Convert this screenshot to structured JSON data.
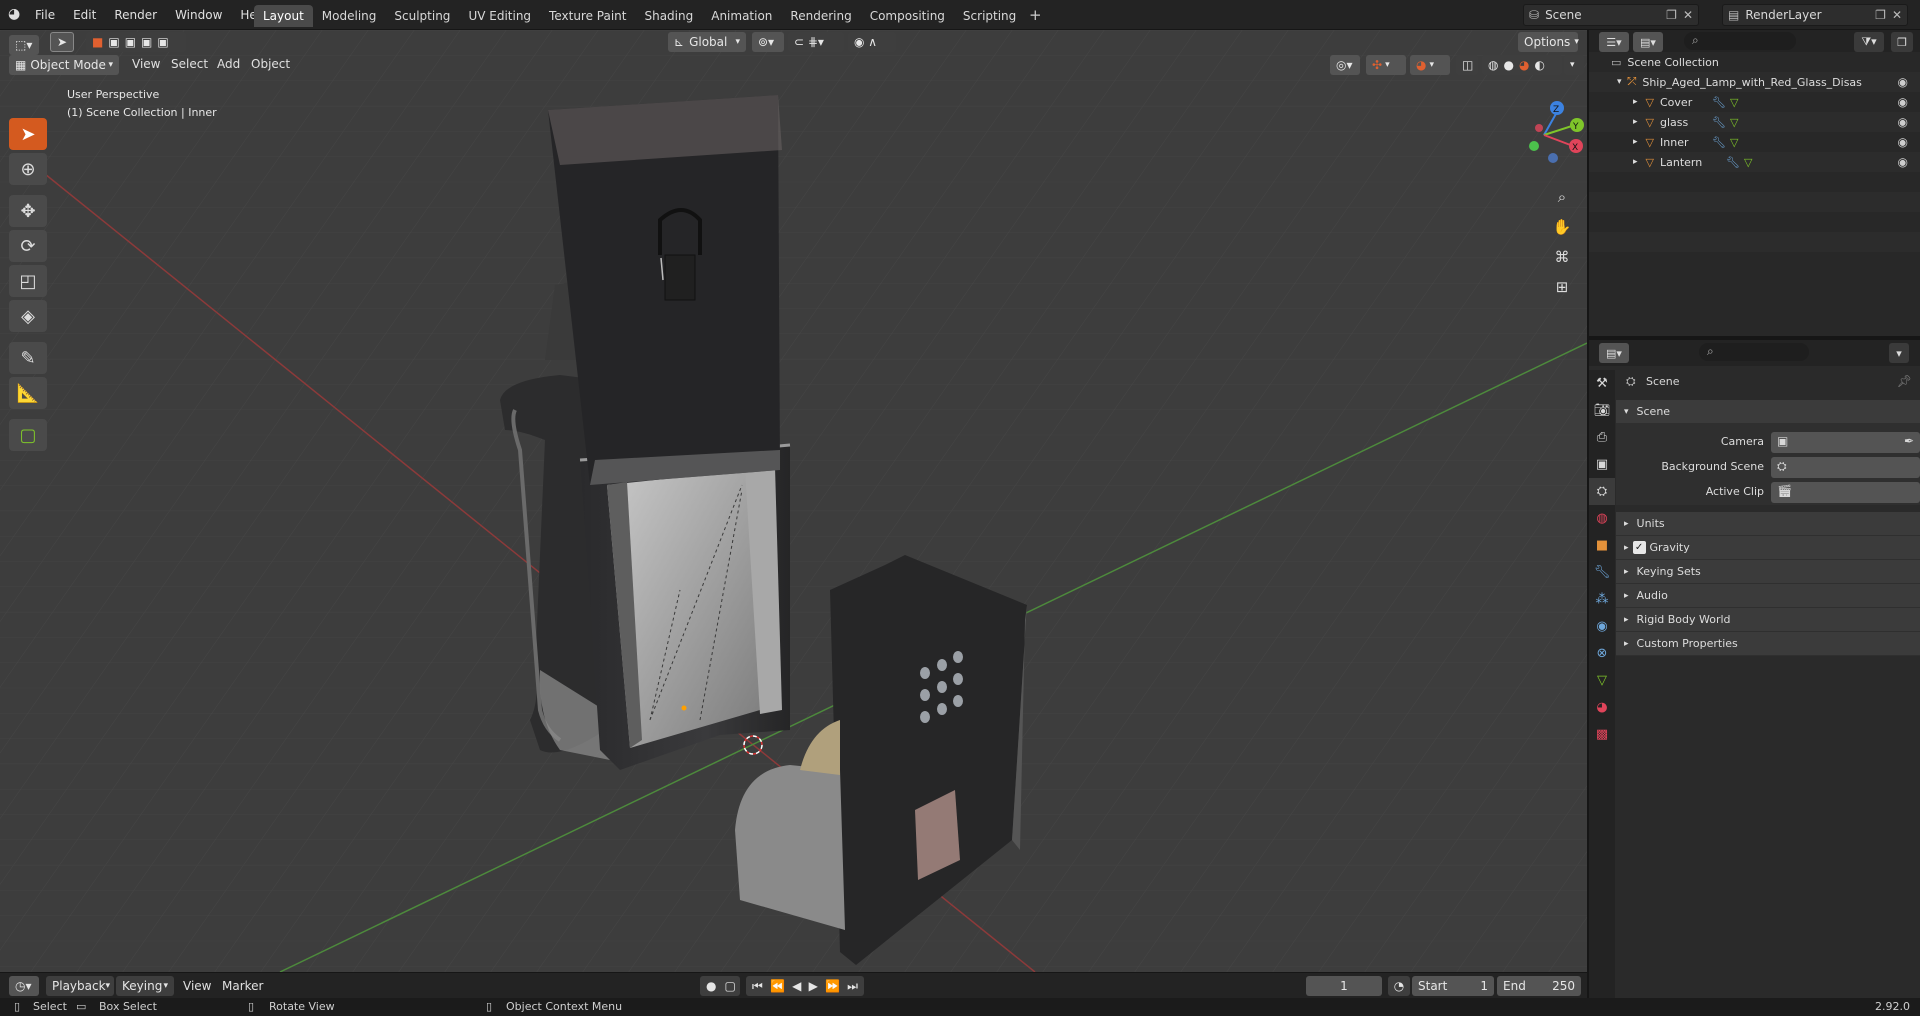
{
  "menu": [
    "File",
    "Edit",
    "Render",
    "Window",
    "Help"
  ],
  "workspace_tabs": [
    "Layout",
    "Modeling",
    "Sculpting",
    "UV Editing",
    "Texture Paint",
    "Shading",
    "Animation",
    "Rendering",
    "Compositing",
    "Scripting"
  ],
  "active_tab": "Layout",
  "scene": {
    "name": "Scene",
    "render_layer": "RenderLayer"
  },
  "viewport_header": {
    "mode": "Object Mode",
    "menus": [
      "View",
      "Select",
      "Add",
      "Object"
    ],
    "transform_orientation": "Global",
    "options": "Options"
  },
  "viewport_info": {
    "perspective": "User Perspective",
    "collection": "(1) Scene Collection | Inner"
  },
  "gizmo_axes": {
    "z": "Z",
    "y": "Y",
    "x": "X"
  },
  "colors": {
    "accent": "#d45a1f",
    "axis_x": "#e0445a",
    "axis_y": "#7fc52a",
    "axis_z": "#3c82e0",
    "grid_red": "#9b3b3b",
    "grid_green": "#4f8f3f"
  },
  "outliner": {
    "root": "Scene Collection",
    "collection": "Ship_Aged_Lamp_with_Red_Glass_Disassem",
    "objects": [
      "Cover",
      "glass",
      "Inner",
      "Lantern"
    ]
  },
  "properties": {
    "context": "Scene",
    "panel": "Scene",
    "fields": {
      "camera": "Camera",
      "background_scene": "Background Scene",
      "active_clip": "Active Clip"
    },
    "sections": [
      "Units",
      "Gravity",
      "Keying Sets",
      "Audio",
      "Rigid Body World",
      "Custom Properties"
    ],
    "gravity_checked": true
  },
  "timeline": {
    "menus": [
      "Playback",
      "Keying",
      "View",
      "Marker"
    ],
    "current_frame": "1",
    "start_label": "Start",
    "start": "1",
    "end_label": "End",
    "end": "250"
  },
  "status_bar": {
    "select": "Select",
    "box_select": "Box Select",
    "rotate_view": "Rotate View",
    "context_menu": "Object Context Menu",
    "version": "2.92.0"
  }
}
